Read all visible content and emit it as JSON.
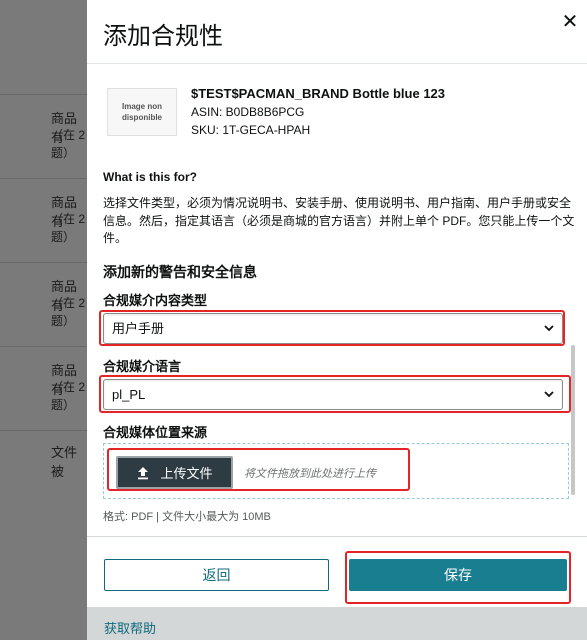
{
  "background": {
    "rows": [
      {
        "t1": "商品有",
        "t2": "（在 2",
        "t3": "题）"
      },
      {
        "t1": "商品有",
        "t2": "（在 2",
        "t3": "题）"
      },
      {
        "t1": "商品有",
        "t2": "（在 2",
        "t3": "题）"
      },
      {
        "t1": "商品有",
        "t2": "（在 2",
        "t3": "题）"
      },
      {
        "t1": "文件被",
        "t2": "",
        "t3": ""
      }
    ]
  },
  "modal": {
    "title": "添加合规性",
    "close_glyph": "✕",
    "product": {
      "image_placeholder": "Image non disponible",
      "name": "$TEST$PACMAN_BRAND Bottle blue 123",
      "asin": "ASIN: B0DB8B6PCG",
      "sku": "SKU: 1T-GECA-HPAH"
    },
    "what_heading": "What is this for?",
    "description": "选择文件类型，必须为情况说明书、安装手册、使用说明书、用户指南、用户手册或安全信息。然后，指定其语言（必须是商城的官方语言）并附上单个 PDF。您只能上传一个文件。",
    "section_heading": "添加新的警告和安全信息",
    "content_type": {
      "label": "合规媒介内容类型",
      "value": "用户手册"
    },
    "language": {
      "label": "合规媒介语言",
      "value": "pl_PL"
    },
    "source": {
      "label": "合规媒体位置来源",
      "upload_label": "上传文件",
      "drop_hint": "将文件拖放到此处进行上传",
      "format_note": "格式:  PDF | 文件大小最大为 10MB"
    },
    "buttons": {
      "back": "返回",
      "save": "保存"
    },
    "help_link": "获取帮助"
  },
  "colors": {
    "accent": "#1a7e91",
    "highlight": "#e3252a",
    "overlay": "#7a7a7a"
  },
  "icons": {
    "close": "close-icon",
    "upload": "upload-icon",
    "chevron": "chevron-down-icon"
  }
}
